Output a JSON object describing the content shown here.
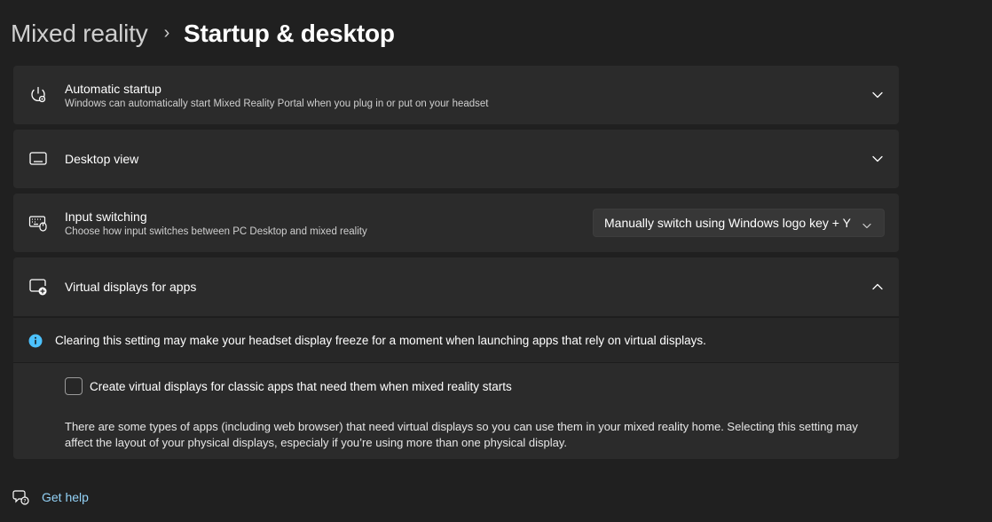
{
  "breadcrumb": {
    "parent": "Mixed reality",
    "separator": "›",
    "current": "Startup & desktop"
  },
  "settings": {
    "automatic_startup": {
      "title": "Automatic startup",
      "description": "Windows can automatically start Mixed Reality Portal when you plug in or put on your headset",
      "icon": "startup-power-icon",
      "expanded": false
    },
    "desktop_view": {
      "title": "Desktop view",
      "icon": "monitor-icon",
      "expanded": false
    },
    "input_switching": {
      "title": "Input switching",
      "description": "Choose how input switches between PC Desktop and mixed reality",
      "icon": "keyboard-mouse-icon",
      "dropdown_value": "Manually switch using Windows logo key + Y"
    },
    "virtual_displays": {
      "title": "Virtual displays for apps",
      "icon": "display-add-icon",
      "expanded": true,
      "info_message": "Clearing this setting may make your headset display freeze for a moment when launching apps that rely on virtual displays.",
      "checkbox_label": "Create virtual displays for classic apps that need them when mixed reality starts",
      "checkbox_checked": false,
      "help_text": "There are some types of apps (including web browser) that need virtual displays so you can use them in your mixed reality home. Selecting this setting may affect the layout of your physical displays, especialy if you’re using more than one physical display."
    }
  },
  "footer": {
    "get_help_label": "Get help"
  },
  "colors": {
    "background": "#202020",
    "card": "#2b2b2b",
    "info_accent": "#4cc2ff",
    "link": "#93d2f7"
  }
}
